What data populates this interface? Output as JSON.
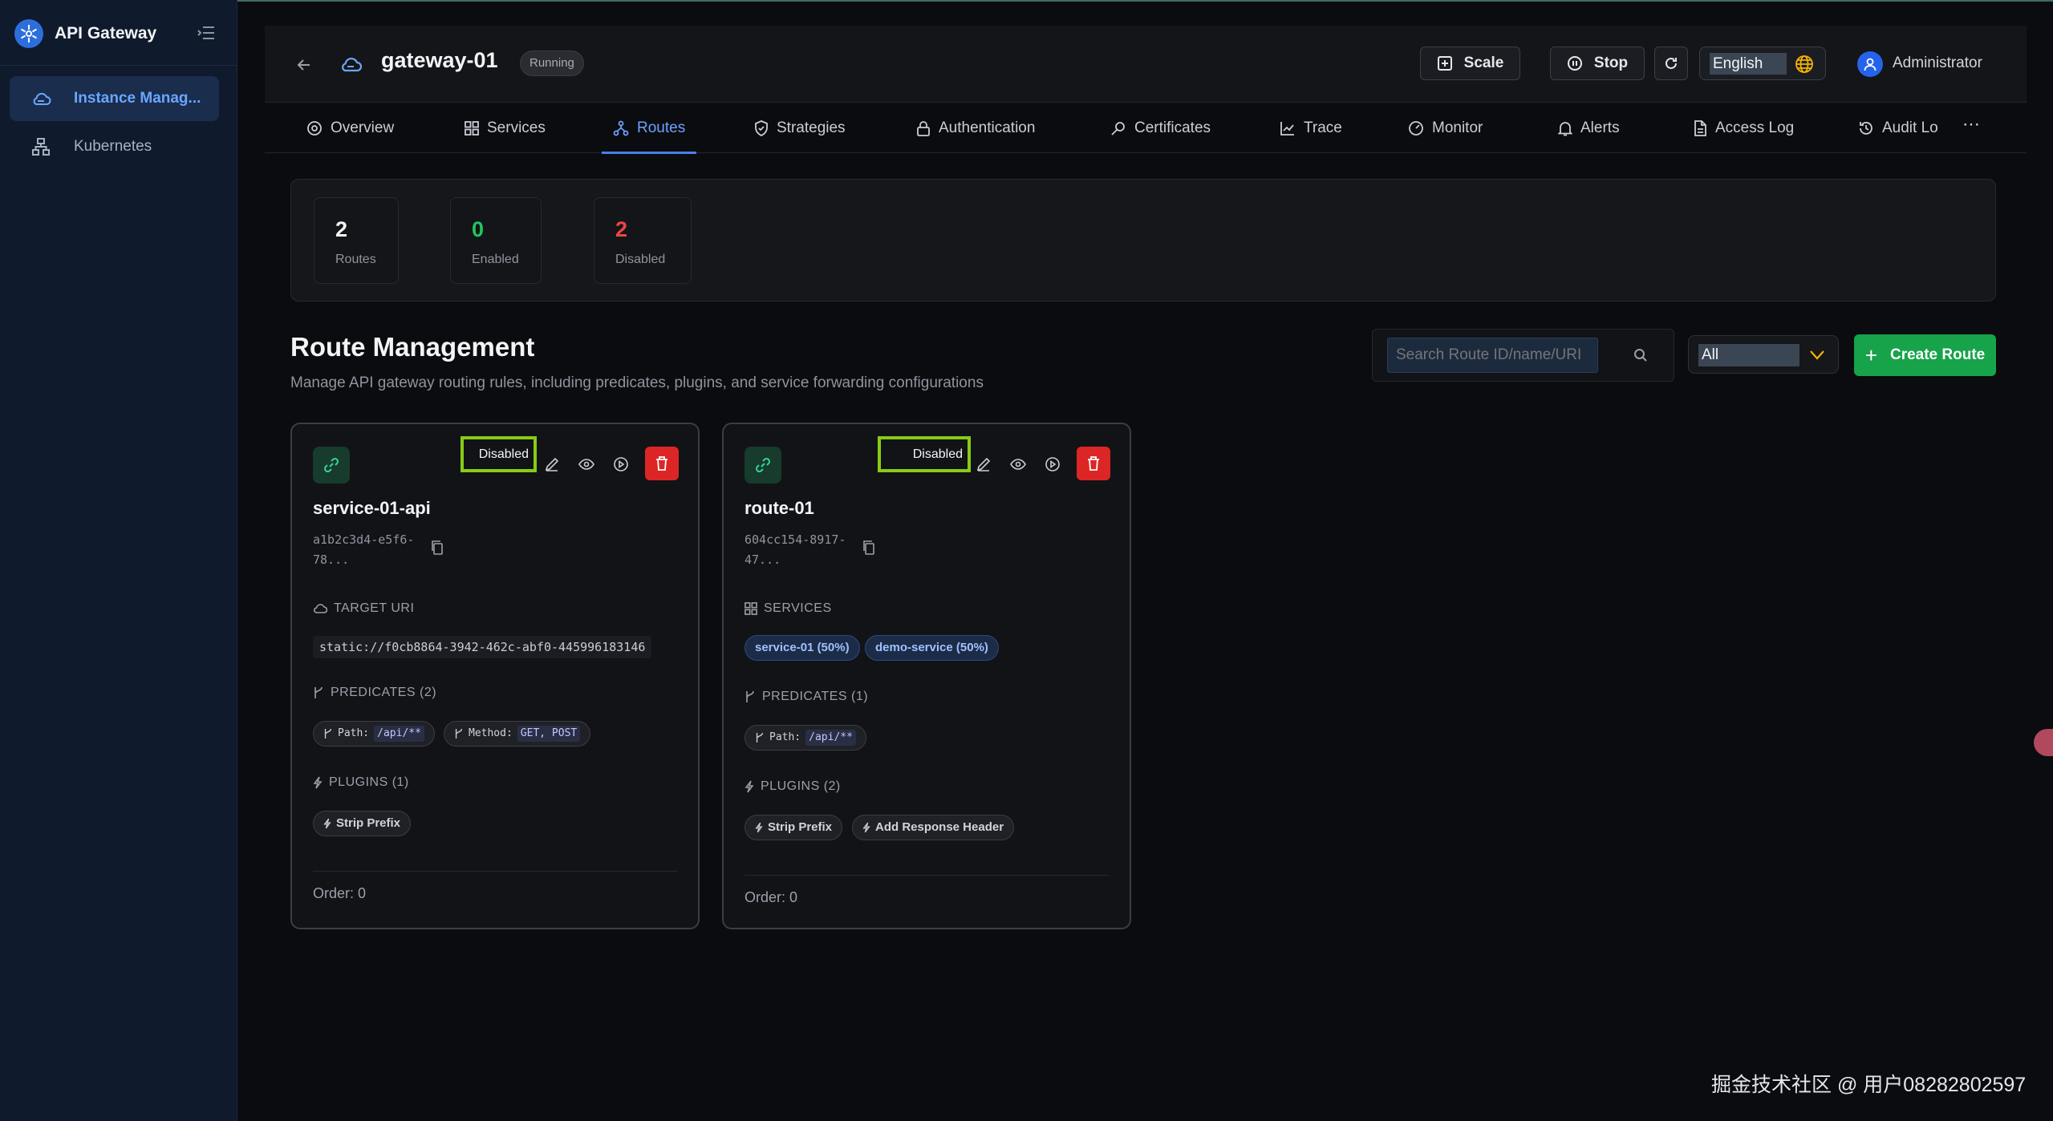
{
  "app": {
    "title": "API Gateway"
  },
  "sidebar": {
    "items": [
      {
        "label": "Instance Manag...",
        "icon": "cloud-icon",
        "active": true
      },
      {
        "label": "Kubernetes",
        "icon": "cluster-icon",
        "active": false
      }
    ]
  },
  "header": {
    "gateway_name": "gateway-01",
    "status": "Running",
    "scale_label": "Scale",
    "stop_label": "Stop",
    "language": "English",
    "user": "Administrator"
  },
  "tabs": [
    {
      "label": "Overview",
      "icon": "eye-icon"
    },
    {
      "label": "Services",
      "icon": "grid-icon"
    },
    {
      "label": "Routes",
      "icon": "route-icon",
      "active": true
    },
    {
      "label": "Strategies",
      "icon": "shield-icon"
    },
    {
      "label": "Authentication",
      "icon": "lock-icon"
    },
    {
      "label": "Certificates",
      "icon": "key-icon"
    },
    {
      "label": "Trace",
      "icon": "chart-line-icon"
    },
    {
      "label": "Monitor",
      "icon": "gauge-icon"
    },
    {
      "label": "Alerts",
      "icon": "bell-icon"
    },
    {
      "label": "Access Log",
      "icon": "file-icon"
    },
    {
      "label": "Audit Log",
      "icon": "history-icon"
    }
  ],
  "stats": [
    {
      "value": "2",
      "label": "Routes",
      "color": "#f3f4f6"
    },
    {
      "value": "0",
      "label": "Enabled",
      "color": "#22c55e"
    },
    {
      "value": "2",
      "label": "Disabled",
      "color": "#ef4444"
    }
  ],
  "route_management": {
    "title": "Route Management",
    "description": "Manage API gateway routing rules, including predicates, plugins, and service forwarding configurations",
    "search_placeholder": "Search Route ID/name/URI",
    "filter_value": "All",
    "create_label": "Create Route"
  },
  "routes": [
    {
      "status": "Disabled",
      "name": "service-01-api",
      "id_line1": "a1b2c3d4-e5f6-",
      "id_line2": "78...",
      "target_title": "TARGET URI",
      "target_uri": "static://f0cb8864-3942-462c-abf0-445996183146",
      "predicates_title": "PREDICATES (2)",
      "predicates": [
        {
          "key": "Path:",
          "value": "/api/**"
        },
        {
          "key": "Method:",
          "value": "GET, POST"
        }
      ],
      "plugins_title": "PLUGINS (1)",
      "plugins": [
        "Strip Prefix"
      ],
      "order": "Order: 0"
    },
    {
      "status": "Disabled",
      "name": "route-01",
      "id_line1": "604cc154-8917-",
      "id_line2": "47...",
      "services_title": "SERVICES",
      "services": [
        "service-01 (50%)",
        "demo-service (50%)"
      ],
      "predicates_title": "PREDICATES (1)",
      "predicates": [
        {
          "key": "Path:",
          "value": "/api/**"
        }
      ],
      "plugins_title": "PLUGINS (2)",
      "plugins": [
        "Strip Prefix",
        "Add Response Header"
      ],
      "order": "Order: 0"
    }
  ],
  "watermark": "掘金技术社区 @ 用户08282802597",
  "colors": {
    "accent": "#4a7fe8",
    "create": "#16a34a",
    "delete": "#dc2626",
    "highlight": "#88cc16"
  }
}
